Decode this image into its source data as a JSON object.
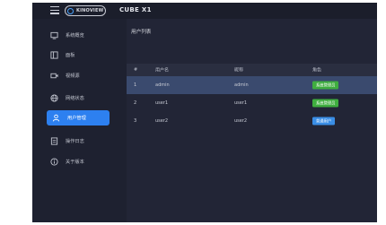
{
  "brand": {
    "logo_text": "KINOVIEW",
    "app_title": "CUBE X1"
  },
  "sidebar": {
    "items": [
      {
        "label": "系统概览",
        "icon": "monitor-icon"
      },
      {
        "label": "面板",
        "icon": "panel-icon"
      },
      {
        "label": "视频源",
        "icon": "video-source-icon"
      },
      {
        "label": "网络状态",
        "icon": "globe-icon"
      },
      {
        "label": "用户管理",
        "icon": "user-icon",
        "active": true
      },
      {
        "label": "操作日志",
        "icon": "log-icon"
      },
      {
        "label": "关于版本",
        "icon": "info-icon"
      }
    ]
  },
  "main": {
    "title": "用户列表",
    "table": {
      "columns": [
        "#",
        "用户名",
        "昵称",
        "角色"
      ],
      "rows": [
        {
          "index": "1",
          "username": "admin",
          "nickname": "admin",
          "role": "系统管理员",
          "role_color": "#3fae3f",
          "selected": true
        },
        {
          "index": "2",
          "username": "user1",
          "nickname": "user1",
          "role": "系统管理员",
          "role_color": "#3fae3f"
        },
        {
          "index": "3",
          "username": "user2",
          "nickname": "user2",
          "role": "普通用户",
          "role_color": "#3a8ee6"
        }
      ]
    }
  },
  "colors": {
    "accent": "#2d80f0",
    "background": "#1f2230"
  }
}
